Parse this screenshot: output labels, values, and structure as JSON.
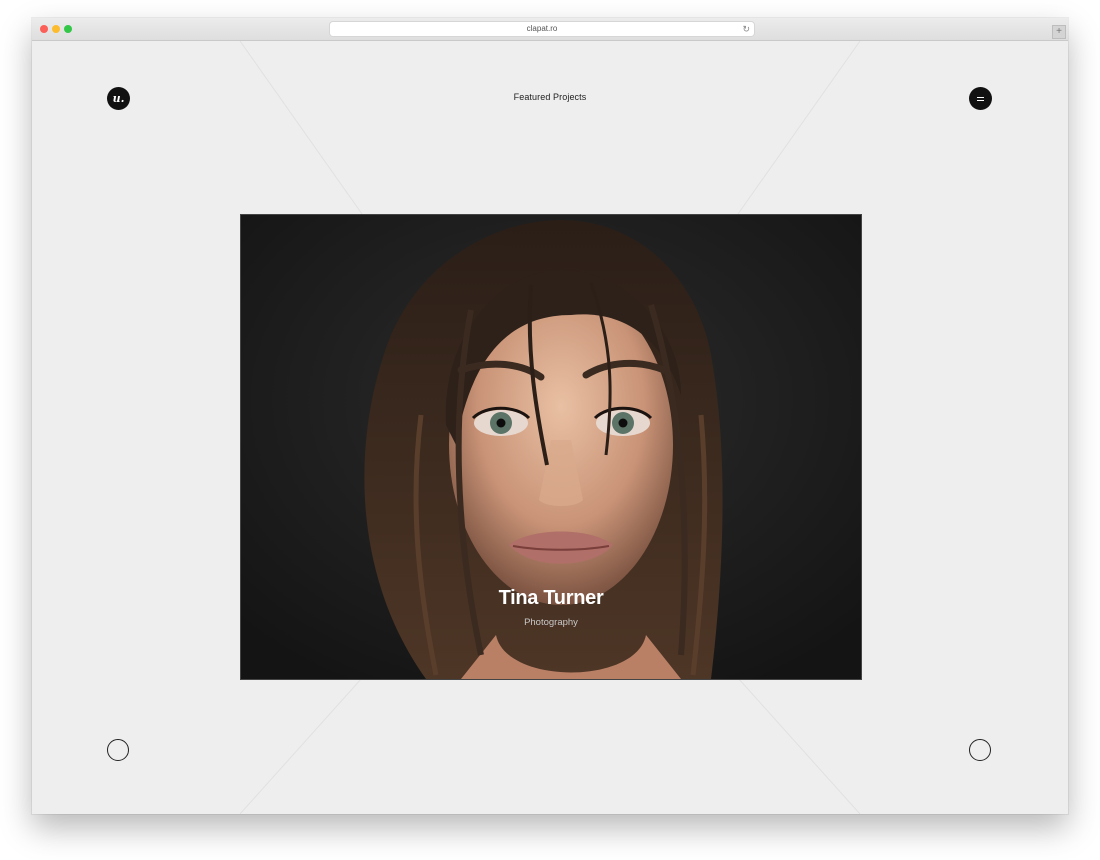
{
  "browser": {
    "url": "clapat.ro",
    "reload_icon": "reload-icon",
    "new_tab_label": "+"
  },
  "header": {
    "logo_text": "u.",
    "title": "Featured Projects"
  },
  "project": {
    "title": "Tina Turner",
    "category": "Photography"
  },
  "colors": {
    "page_background": "#eeeeee",
    "ui_dark": "#111111",
    "text_white": "#ffffff",
    "subtitle_gray": "#c8c8c8"
  }
}
